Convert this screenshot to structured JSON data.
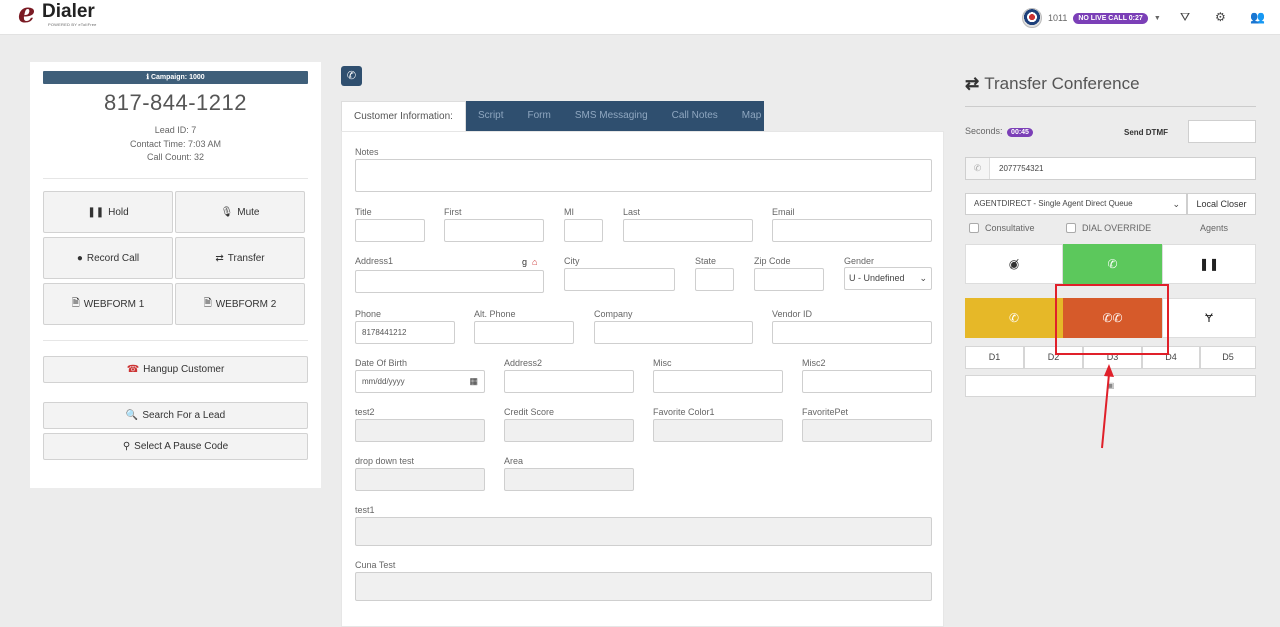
{
  "header": {
    "logo_e": "e",
    "logo_name": "Dialer",
    "logo_tagline": "POWERED BY eTollFree",
    "extension": "1011",
    "live_status": "NO LIVE CALL 0:27"
  },
  "left": {
    "campaign": "Campaign: 1000",
    "phone_number": "817-844-1212",
    "lead_id": "Lead ID: 7",
    "contact_time": "Contact Time: 7:03 AM",
    "call_count": "Call Count: 32",
    "hold": "Hold",
    "mute": "Mute",
    "record_call": "Record Call",
    "transfer": "Transfer",
    "webform1": "WEBFORM 1",
    "webform2": "WEBFORM 2",
    "hangup": "Hangup Customer",
    "search_lead": "Search For a Lead",
    "pause_code": "Select A Pause Code"
  },
  "tabs": [
    "Customer Information:",
    "Script",
    "Form",
    "SMS Messaging",
    "Call Notes",
    "Map"
  ],
  "form": {
    "notes": "Notes",
    "title": "Title",
    "first": "First",
    "mi": "MI",
    "last": "Last",
    "email": "Email",
    "address1": "Address1",
    "city": "City",
    "state": "State",
    "zip": "Zip Code",
    "gender": "Gender",
    "gender_value": "U - Undefined",
    "phone": "Phone",
    "phone_value": "8178441212",
    "alt_phone": "Alt. Phone",
    "company": "Company",
    "vendor_id": "Vendor ID",
    "dob": "Date Of Birth",
    "dob_placeholder": "mm/dd/yyyy",
    "address2": "Address2",
    "misc": "Misc",
    "misc2": "Misc2",
    "test2": "test2",
    "credit_score": "Credit Score",
    "favorite_color": "Favorite Color1",
    "favorite_pet": "FavoritePet",
    "dropdown_test": "drop down test",
    "area": "Area",
    "test1": "test1",
    "cuna_test": "Cuna Test"
  },
  "transfer": {
    "title": "Transfer Conference",
    "seconds_label": "Seconds:",
    "seconds_value": "00:45",
    "send_dtmf": "Send DTMF",
    "number": "2077754321",
    "agent_queue": "AGENTDIRECT - Single Agent Direct Queue",
    "local_closer": "Local Closer",
    "consultative": "Consultative",
    "dial_override": "DIAL OVERRIDE",
    "agents": "Agents",
    "dial_buttons": [
      "D1",
      "D2",
      "D3",
      "D4",
      "D5"
    ],
    "colors": {
      "green": "#5cc85c",
      "yellow": "#e6b828",
      "orange": "#d65a2a",
      "highlight": "#e0202a"
    }
  }
}
